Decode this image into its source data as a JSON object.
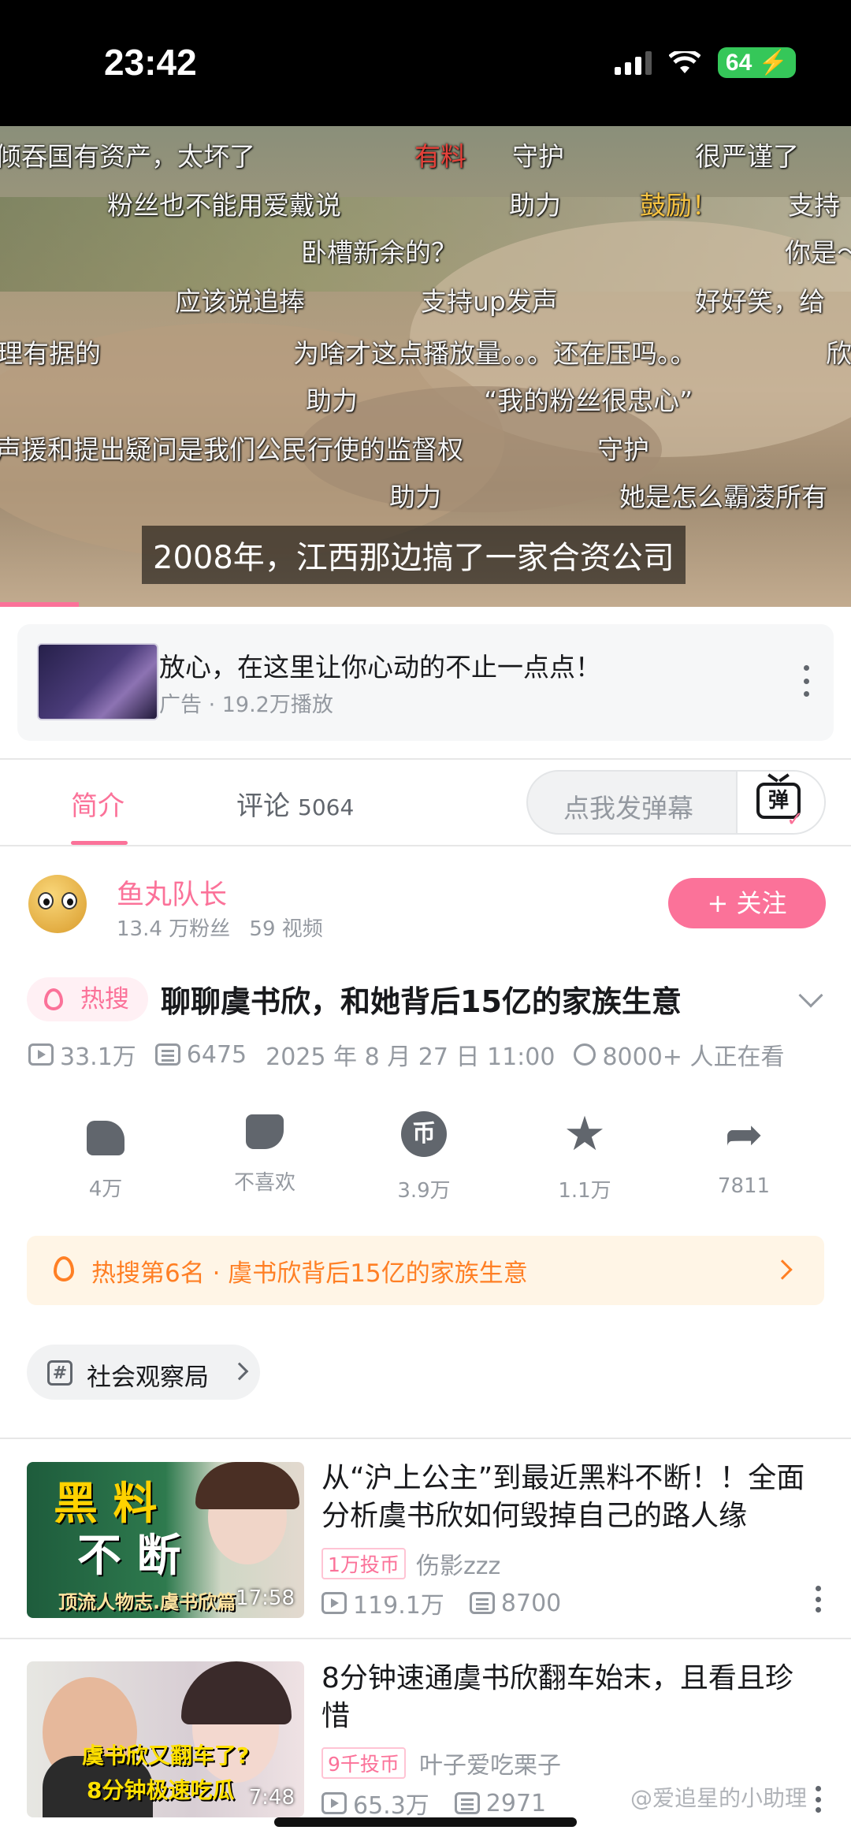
{
  "status_bar": {
    "time": "23:42",
    "battery": "64"
  },
  "video": {
    "subtitle": "2008年，江西那边搞了一家合资公司",
    "danmaku": [
      {
        "text": "倾吞国有资产，太坏了",
        "color": "white"
      },
      {
        "text": "有料",
        "color": "red"
      },
      {
        "text": "守护",
        "color": "white"
      },
      {
        "text": "很严谨了",
        "color": "white"
      },
      {
        "text": "粉丝也不能用爱戴说",
        "color": "white"
      },
      {
        "text": "助力",
        "color": "white"
      },
      {
        "text": "鼓励！",
        "color": "orange"
      },
      {
        "text": "支持",
        "color": "white"
      },
      {
        "text": "卧槽新余的？",
        "color": "white"
      },
      {
        "text": "你是～",
        "color": "white"
      },
      {
        "text": "应该说追捧",
        "color": "white"
      },
      {
        "text": "支持up发声",
        "color": "white"
      },
      {
        "text": "好好笑，给",
        "color": "white"
      },
      {
        "text": "理有据的",
        "color": "white"
      },
      {
        "text": "为啥才这点播放量。。。还在压吗。。",
        "color": "white"
      },
      {
        "text": "欣",
        "color": "white"
      },
      {
        "text": "助力",
        "color": "white"
      },
      {
        "text": "“我的粉丝很忠心”",
        "color": "white"
      },
      {
        "text": "声援和提出疑问是我们公民行使的监督权",
        "color": "white"
      },
      {
        "text": "守护",
        "color": "white"
      },
      {
        "text": "助力",
        "color": "white"
      },
      {
        "text": "她是怎么霸凌所有",
        "color": "white"
      }
    ]
  },
  "ad": {
    "title": "放心，在这里让你心动的不止一点点！",
    "subtitle": "广告 · 19.2万播放"
  },
  "tabs": {
    "intro": "简介",
    "comments": "评论",
    "comments_count": "5064",
    "danmu_placeholder": "点我发弹幕",
    "danmu_icon": "弹"
  },
  "uploader": {
    "name": "鱼丸队长",
    "fans": "13.4 万粉丝",
    "videos": "59 视频",
    "follow": "+ 关注"
  },
  "video_info": {
    "hot_tag": "热搜",
    "title": "聊聊虞书欣，和她背后15亿的家族生意",
    "views": "33.1万",
    "danmaku_count": "6475",
    "date": "2025 年 8 月 27 日  11:00",
    "watching": "8000+ 人正在看"
  },
  "actions": [
    {
      "icon": "thumbs-up-icon",
      "label": "4万"
    },
    {
      "icon": "thumbs-down-icon",
      "label": "不喜欢"
    },
    {
      "icon": "coin-icon",
      "label": "3.9万"
    },
    {
      "icon": "star-icon",
      "label": "1.1万"
    },
    {
      "icon": "share-icon",
      "label": "7811"
    }
  ],
  "hot_banner": "热搜第6名 · 虞书欣背后15亿的家族生意",
  "topic": "社会观察局",
  "related": [
    {
      "title": "从“沪上公主”到最近黑料不断！！全面分析虞书欣如何毁掉自己的路人缘",
      "thumb_big1": "黑 料",
      "thumb_big2": "不 断",
      "thumb_caption": "顶流人物志.虞书欣篇",
      "duration": "17:58",
      "coins": "1万投币",
      "author": "伤影zzz",
      "views": "119.1万",
      "danmaku": "8700"
    },
    {
      "title": "8分钟速通虞书欣翻车始末，且看且珍惜",
      "thumb_caption1": "虞书欣又翻车了?",
      "thumb_caption2": "8分钟极速吃瓜",
      "duration": "7:48",
      "coins": "9千投币",
      "author": "叶子爱吃栗子",
      "views": "65.3万",
      "danmaku": "2971"
    }
  ],
  "watermark": "@爱追星的小助理",
  "colors": {
    "accent": "#fb7299",
    "hot_orange": "#ff7f24"
  }
}
